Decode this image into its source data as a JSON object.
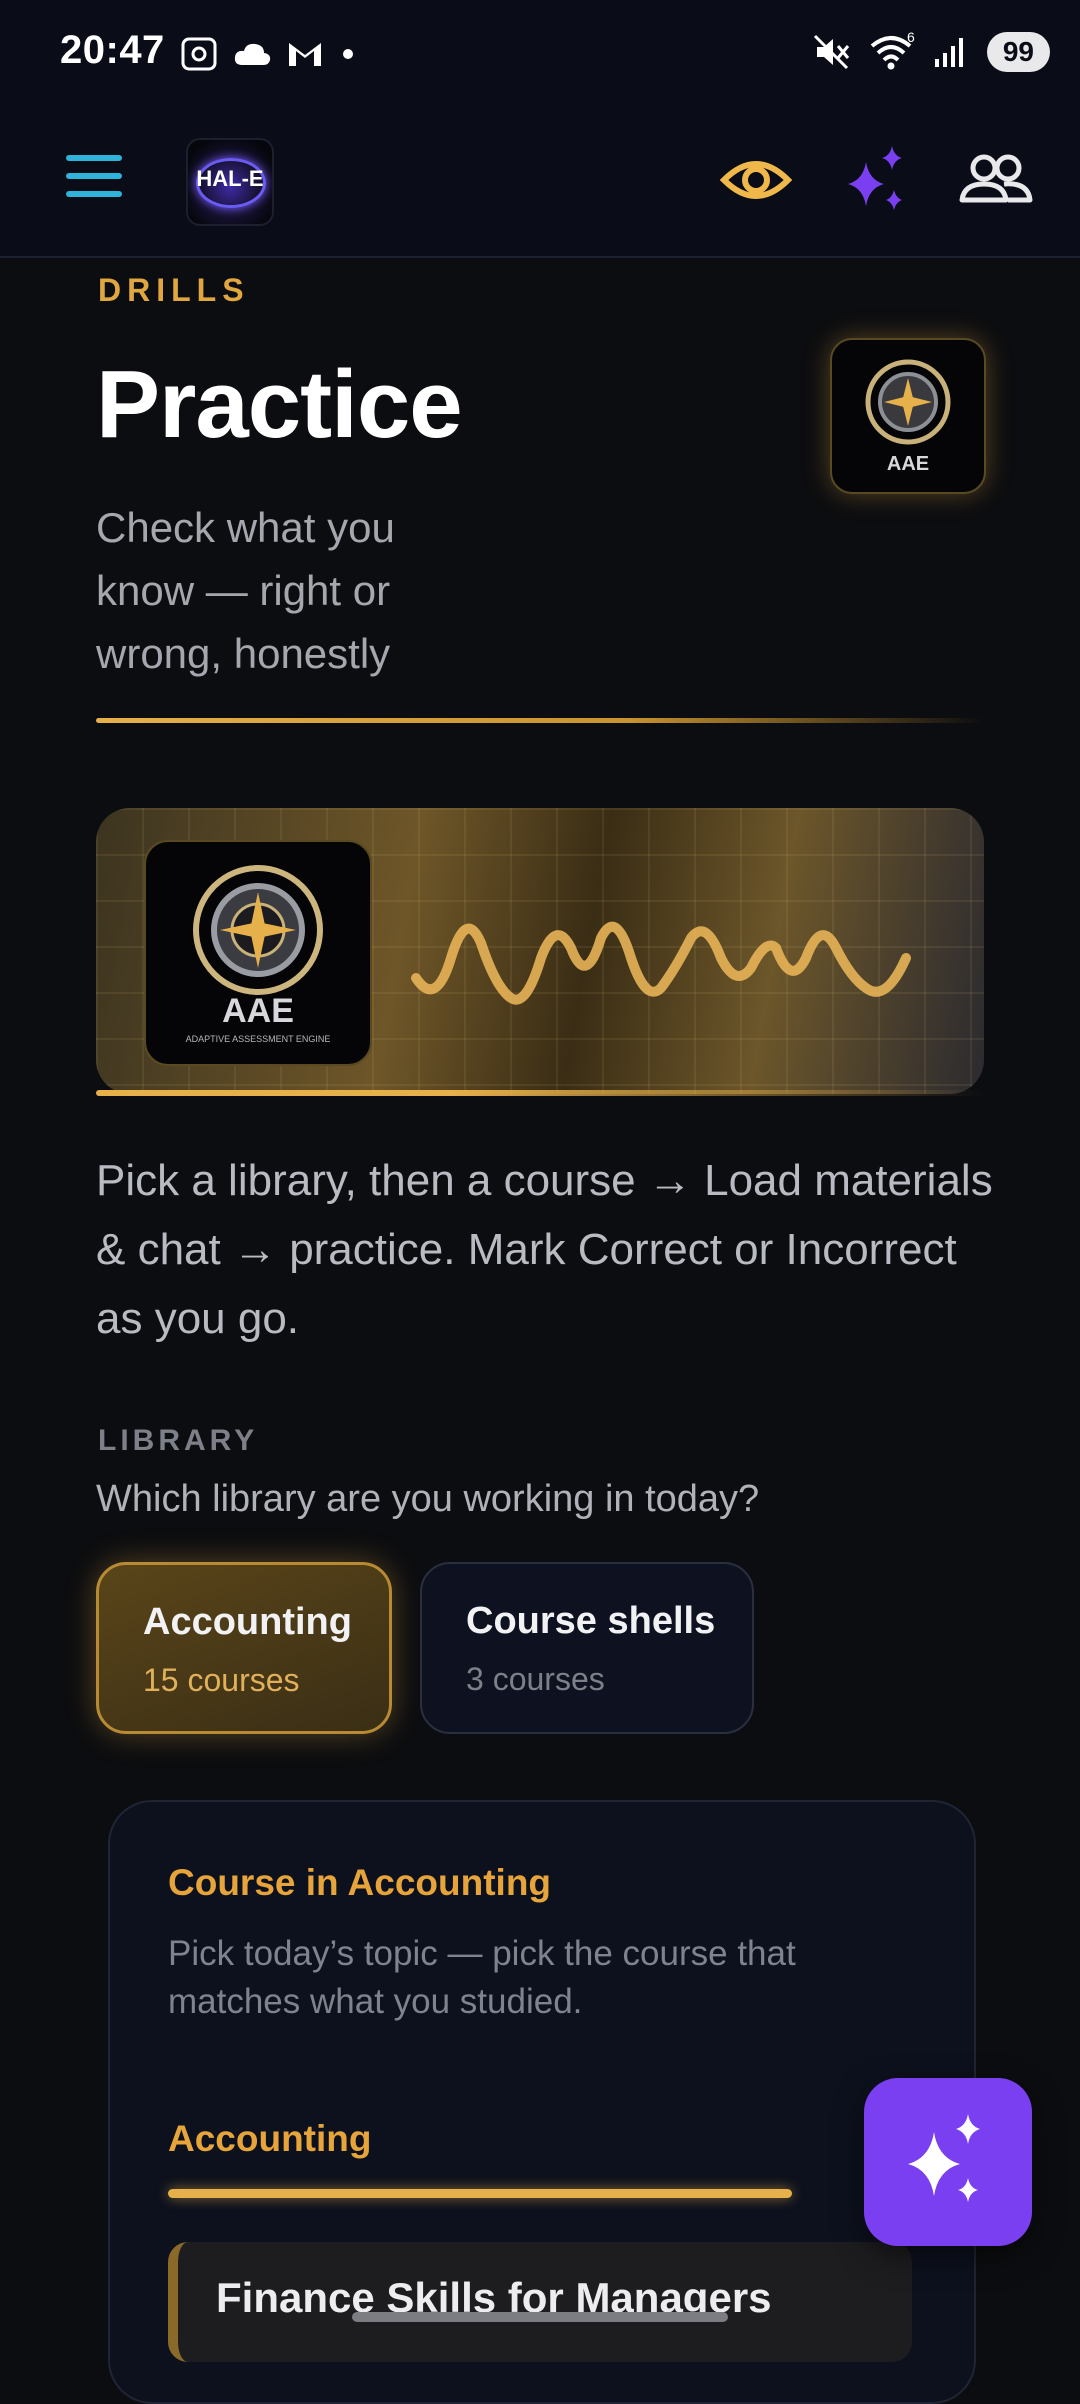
{
  "status_bar": {
    "time": "20:47",
    "battery": "99",
    "icons": [
      "screenshot-icon",
      "cloud-icon",
      "gmail-icon",
      "dot-icon",
      "mute-icon",
      "wifi-icon",
      "signal-icon"
    ]
  },
  "header": {
    "logo_text": "HAL-E",
    "icons": [
      "menu-icon",
      "eye-icon",
      "sparkle-icon",
      "people-icon"
    ],
    "colors": {
      "menu": "#2fb3d9",
      "eye": "#f0b84a",
      "sparkle": "#7a3ff0",
      "people": "#e9e9ec"
    }
  },
  "page": {
    "eyebrow": "DRILLS",
    "title": "Practice",
    "subtitle": "Check what you know — right or wrong, honestly",
    "badge_text": "AAE",
    "hero_logo_text": "AAE",
    "hero_logo_subtext": "ADAPTIVE ASSESSMENT ENGINE",
    "description": "Pick a library, then a course → Load materials & chat → practice. Mark Correct or Incorrect as you go."
  },
  "library": {
    "eyebrow": "LIBRARY",
    "question": "Which library are you working in today?",
    "chips": [
      {
        "name": "Accounting",
        "count": "15 courses",
        "selected": true
      },
      {
        "name": "Course shells",
        "count": "3 courses",
        "selected": false
      }
    ]
  },
  "course_panel": {
    "title": "Course in Accounting",
    "subtitle": "Pick today’s topic — pick the course that matches what you studied.",
    "section": "Accounting",
    "courses": [
      "Finance Skills for Managers"
    ]
  },
  "accent_colors": {
    "gold": "#e6a43a",
    "purple": "#7a3ff0",
    "cyan": "#2fb3d9"
  }
}
